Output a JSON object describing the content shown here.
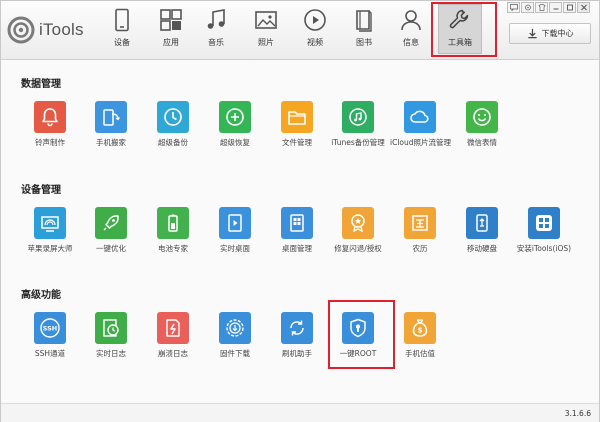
{
  "app": {
    "logo_text": "iTools",
    "version": "3.1.6.6"
  },
  "nav": [
    {
      "label": "设备",
      "icon": "phone-icon"
    },
    {
      "label": "应用",
      "icon": "apps-icon"
    },
    {
      "label": "音乐",
      "icon": "music-icon"
    },
    {
      "label": "照片",
      "icon": "photo-icon"
    },
    {
      "label": "视频",
      "icon": "video-icon"
    },
    {
      "label": "图书",
      "icon": "book-icon"
    },
    {
      "label": "信息",
      "icon": "user-icon"
    },
    {
      "label": "工具箱",
      "icon": "wrench-icon",
      "active": true
    }
  ],
  "download": {
    "label": "下载中心"
  },
  "sections": [
    {
      "title": "数据管理",
      "tools": [
        {
          "label": "铃声制作",
          "icon": "bell-icon",
          "color": "#e45a45"
        },
        {
          "label": "手机搬家",
          "icon": "phone-transfer-icon",
          "color": "#3d95df"
        },
        {
          "label": "超级备份",
          "icon": "clock-backup-icon",
          "color": "#30a8d6"
        },
        {
          "label": "超级恢复",
          "icon": "restore-icon",
          "color": "#34b556"
        },
        {
          "label": "文件管理",
          "icon": "folder-icon",
          "color": "#f5a623"
        },
        {
          "label": "iTunes备份管理",
          "icon": "itunes-icon",
          "color": "#2fae63"
        },
        {
          "label": "iCloud照片流管理",
          "icon": "cloud-icon",
          "color": "#3198e2"
        },
        {
          "label": "微信表情",
          "icon": "smile-icon",
          "color": "#44b649"
        }
      ]
    },
    {
      "title": "设备管理",
      "tools": [
        {
          "label": "苹果录屏大师",
          "icon": "screen-cast-icon",
          "color": "#2c9fd9"
        },
        {
          "label": "一键优化",
          "icon": "rocket-icon",
          "color": "#3fae49"
        },
        {
          "label": "电池专家",
          "icon": "battery-icon",
          "color": "#43b14d"
        },
        {
          "label": "实时桌面",
          "icon": "play-screen-icon",
          "color": "#3b92dc"
        },
        {
          "label": "桌面管理",
          "icon": "grid-icon",
          "color": "#3c8fdb"
        },
        {
          "label": "修复闪退/授权",
          "icon": "badge-star-icon",
          "color": "#f0a536"
        },
        {
          "label": "农历",
          "icon": "calendar-icon",
          "color": "#f0a536"
        },
        {
          "label": "移动硬盘",
          "icon": "usb-drive-icon",
          "color": "#2f7fc9"
        },
        {
          "label": "安装iTools(iOS)",
          "icon": "itools-install-icon",
          "color": "#2f7fc9"
        }
      ]
    },
    {
      "title": "高级功能",
      "tools": [
        {
          "label": "SSH通道",
          "icon": "ssh-icon",
          "color": "#3a8fda"
        },
        {
          "label": "实时日志",
          "icon": "log-clock-icon",
          "color": "#3fae49"
        },
        {
          "label": "崩溃日志",
          "icon": "crash-log-icon",
          "color": "#e9605a"
        },
        {
          "label": "固件下载",
          "icon": "firmware-gear-icon",
          "color": "#3a8fda"
        },
        {
          "label": "刷机助手",
          "icon": "flash-cycle-icon",
          "color": "#3a8fda"
        },
        {
          "label": "一键ROOT",
          "icon": "root-shield-icon",
          "color": "#3a8fda"
        },
        {
          "label": "手机估值",
          "icon": "money-bag-icon",
          "color": "#f0a536"
        }
      ]
    }
  ]
}
